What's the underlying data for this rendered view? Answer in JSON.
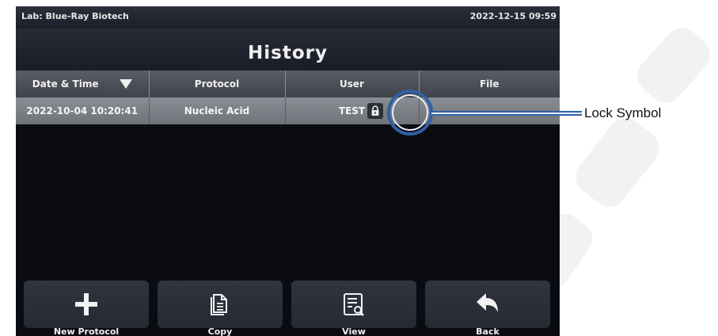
{
  "status_bar": {
    "lab": "Lab: Blue-Ray Biotech",
    "datetime": "2022-12-15 09:59"
  },
  "page_title": "History",
  "table": {
    "columns": [
      "Date & Time",
      "Protocol",
      "User",
      "File"
    ],
    "sort_icon": "triangle-down-icon",
    "rows": [
      {
        "date_time": "2022-10-04 10:20:41",
        "protocol": "Nucleic Acid",
        "user": "TEST",
        "file": "",
        "locked": true,
        "lock_icon": "lock-icon"
      }
    ]
  },
  "toolbar": {
    "buttons": [
      {
        "label": "New Protocol",
        "icon": "plus-icon"
      },
      {
        "label": "Copy",
        "icon": "copy-icon"
      },
      {
        "label": "View",
        "icon": "view-list-icon"
      },
      {
        "label": "Back",
        "icon": "back-arrow-icon"
      }
    ]
  },
  "annotation": {
    "label": "Lock Symbol",
    "color": "#2f62a4"
  }
}
